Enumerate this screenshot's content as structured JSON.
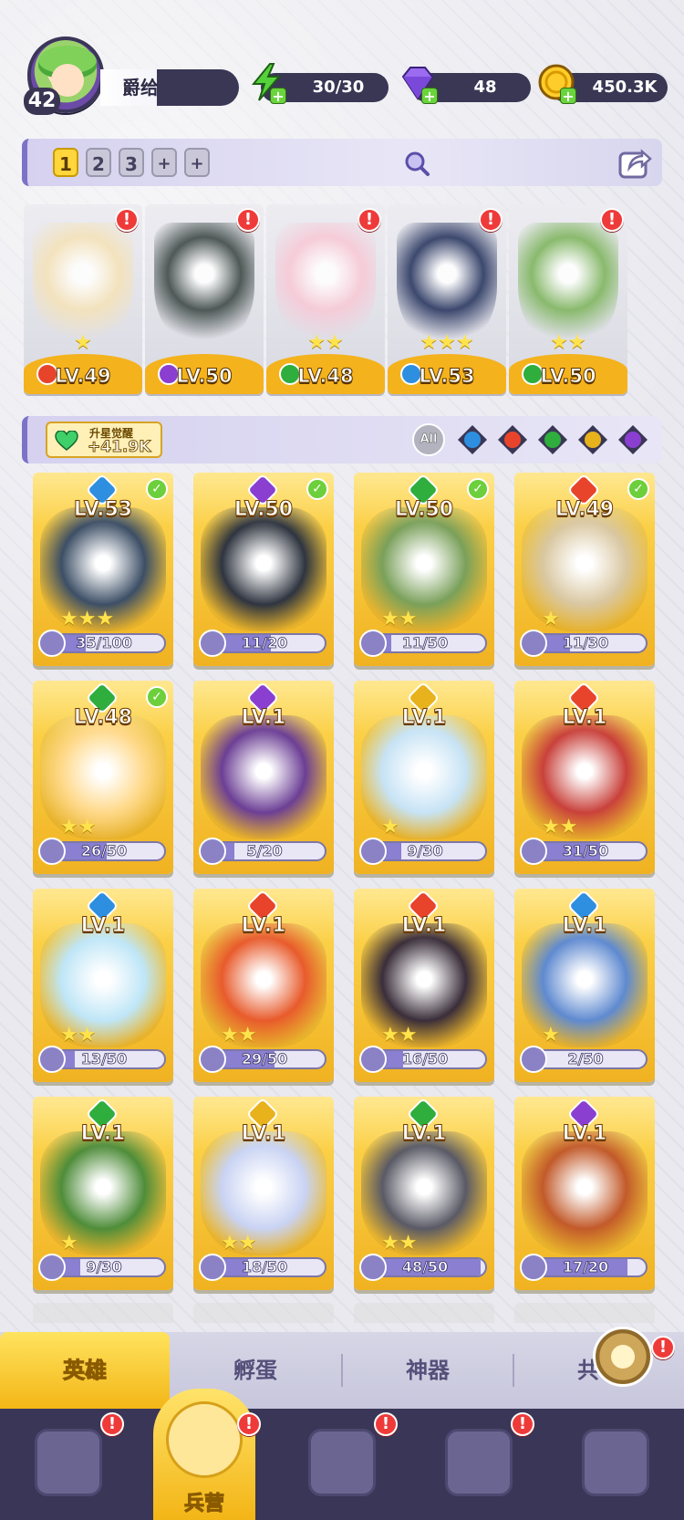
{
  "profile": {
    "level": "42",
    "name": "爵给"
  },
  "resources": {
    "energy": "30/30",
    "gems": "48",
    "gold": "450.3K"
  },
  "team_tabs": [
    "1",
    "2",
    "3",
    "+",
    "+"
  ],
  "active_team_tab": "1",
  "team_heroes": [
    {
      "level": "LV.49",
      "stars": "★",
      "element": "fire",
      "alert": "!"
    },
    {
      "level": "LV.50",
      "stars": "",
      "element": "dark",
      "alert": "!"
    },
    {
      "level": "LV.48",
      "stars": "★★",
      "element": "wind",
      "alert": "!"
    },
    {
      "level": "LV.53",
      "stars": "★★★",
      "element": "water",
      "alert": "!"
    },
    {
      "level": "LV.50",
      "stars": "★★",
      "element": "wind",
      "alert": "!"
    }
  ],
  "awaken": {
    "label": "升星觉醒",
    "value": "+41.9K"
  },
  "filters": {
    "all": "All",
    "elements": [
      "water",
      "fire",
      "wind",
      "light",
      "dark"
    ]
  },
  "heroes": [
    {
      "level": "LV.53",
      "element": "water",
      "shards": "35/100",
      "progress": 0.35,
      "stars": "★★★",
      "owned": true
    },
    {
      "level": "LV.50",
      "element": "dark",
      "shards": "11/20",
      "progress": 0.55,
      "stars": "",
      "owned": true
    },
    {
      "level": "LV.50",
      "element": "wind",
      "shards": "11/50",
      "progress": 0.22,
      "stars": "★★",
      "owned": true
    },
    {
      "level": "LV.49",
      "element": "fire",
      "shards": "11/30",
      "progress": 0.37,
      "stars": "★",
      "owned": true
    },
    {
      "level": "LV.48",
      "element": "wind",
      "shards": "26/50",
      "progress": 0.52,
      "stars": "★★",
      "owned": true
    },
    {
      "level": "LV.1",
      "element": "dark",
      "shards": "5/20",
      "progress": 0.25,
      "stars": "",
      "owned": false
    },
    {
      "level": "LV.1",
      "element": "light",
      "shards": "9/30",
      "progress": 0.3,
      "stars": "★",
      "owned": false
    },
    {
      "level": "LV.1",
      "element": "fire",
      "shards": "31/50",
      "progress": 0.62,
      "stars": "★★",
      "owned": false
    },
    {
      "level": "LV.1",
      "element": "water",
      "shards": "13/50",
      "progress": 0.26,
      "stars": "★★",
      "owned": false
    },
    {
      "level": "LV.1",
      "element": "fire",
      "shards": "29/50",
      "progress": 0.58,
      "stars": "★★",
      "owned": false
    },
    {
      "level": "LV.1",
      "element": "fire",
      "shards": "16/50",
      "progress": 0.32,
      "stars": "★★",
      "owned": false
    },
    {
      "level": "LV.1",
      "element": "water",
      "shards": "2/50",
      "progress": 0.04,
      "stars": "★",
      "owned": false
    },
    {
      "level": "LV.1",
      "element": "wind",
      "shards": "9/30",
      "progress": 0.3,
      "stars": "★",
      "owned": false
    },
    {
      "level": "LV.1",
      "element": "light",
      "shards": "18/50",
      "progress": 0.36,
      "stars": "★★",
      "owned": false
    },
    {
      "level": "LV.1",
      "element": "wind",
      "shards": "48/50",
      "progress": 0.96,
      "stars": "★★",
      "owned": false
    },
    {
      "level": "LV.1",
      "element": "dark",
      "shards": "17/20",
      "progress": 0.85,
      "stars": "",
      "owned": false
    }
  ],
  "sub_tabs": [
    "英雄",
    "孵蛋",
    "神器",
    "共鸣"
  ],
  "nav": {
    "active_label": "兵营"
  },
  "colors": {
    "fire": "#e8442b",
    "water": "#2e8fe0",
    "wind": "#2fae3e",
    "light": "#e8b21c",
    "dark": "#8a3fd1",
    "card_gold": "#f0b221",
    "accent": "#7c72c8"
  }
}
